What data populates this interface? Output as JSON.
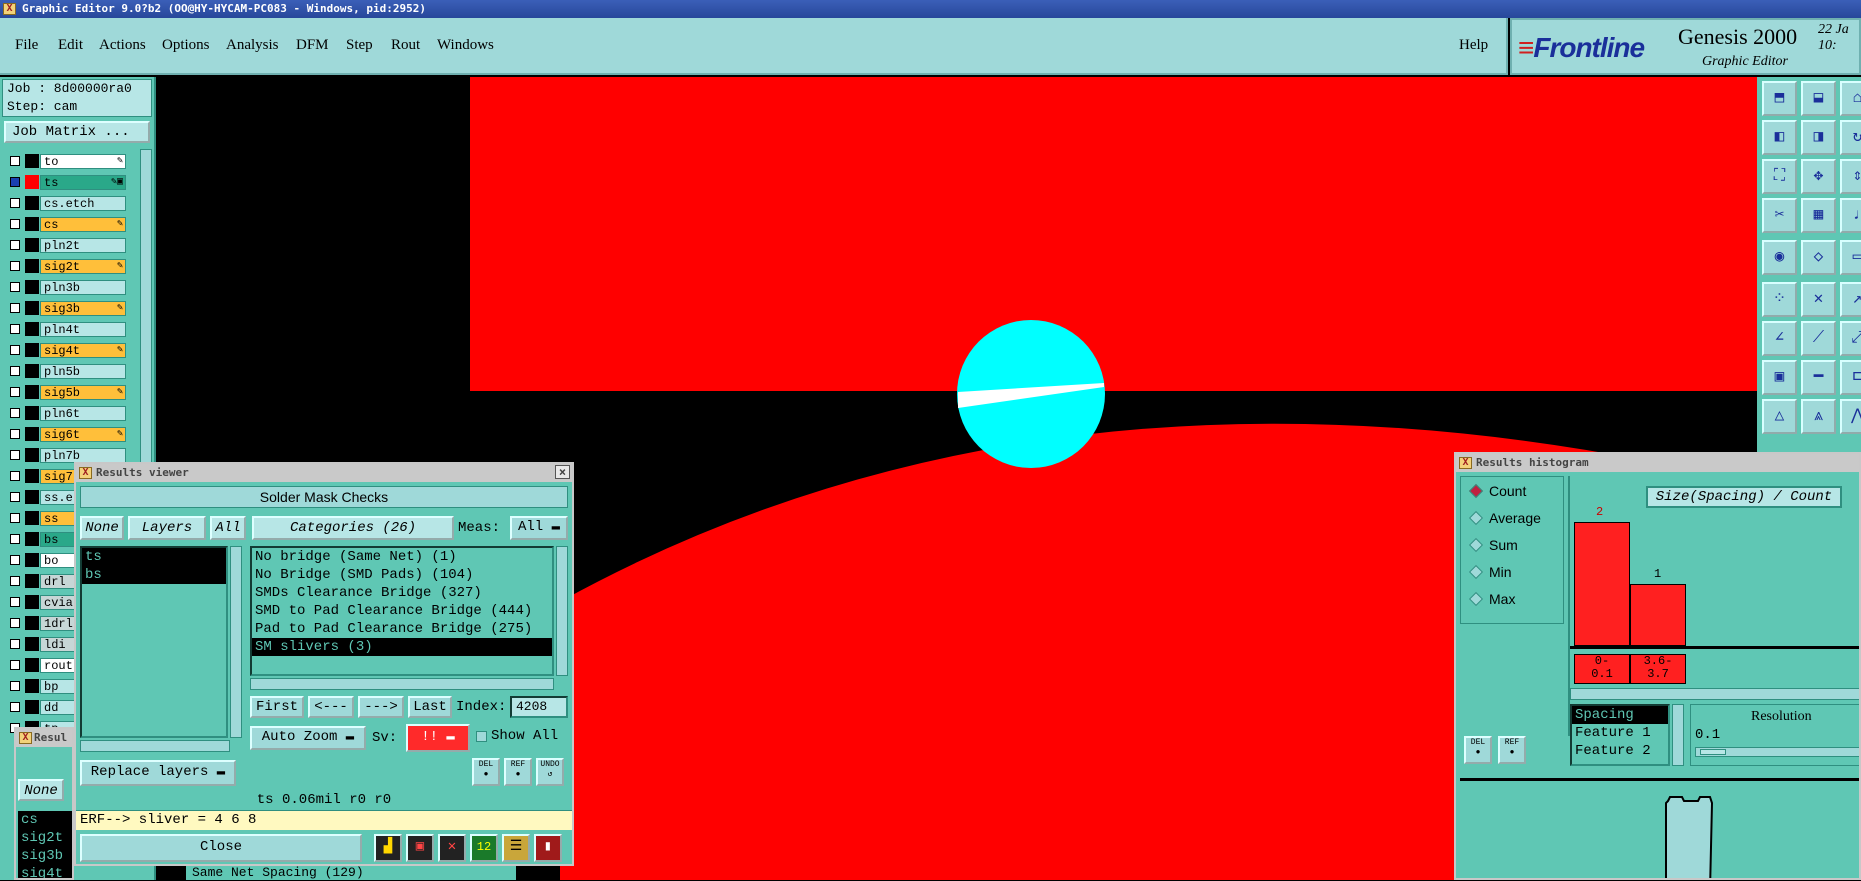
{
  "app": {
    "title": "Graphic Editor 9.0?b2 (OO@HY-HYCAM-PC083 - Windows, pid:2952)"
  },
  "menu": [
    "File",
    "Edit",
    "Actions",
    "Options",
    "Analysis",
    "DFM",
    "Step",
    "Rout",
    "Windows"
  ],
  "help": "Help",
  "logo": {
    "brand": "Frontline",
    "product": "Genesis 2000",
    "subtitle": "Graphic Editor",
    "date_line1": "22 Ja",
    "date_line2": "10:"
  },
  "job": {
    "job_line": "Job : 8d00000ra0",
    "step_line": "Step: cam",
    "matrix_button": "Job Matrix ..."
  },
  "layers": [
    {
      "name": "to",
      "style": "white",
      "marks": "✎"
    },
    {
      "name": "ts",
      "style": "green",
      "marks": "✎▣",
      "selected": true
    },
    {
      "name": "cs.etch",
      "style": "plain",
      "marks": ""
    },
    {
      "name": "cs",
      "style": "orange",
      "marks": "✎"
    },
    {
      "name": "pln2t",
      "style": "plain",
      "marks": ""
    },
    {
      "name": "sig2t",
      "style": "orange",
      "marks": "✎"
    },
    {
      "name": "pln3b",
      "style": "plain",
      "marks": ""
    },
    {
      "name": "sig3b",
      "style": "orange",
      "marks": "✎"
    },
    {
      "name": "pln4t",
      "style": "plain",
      "marks": ""
    },
    {
      "name": "sig4t",
      "style": "orange",
      "marks": "✎"
    },
    {
      "name": "pln5b",
      "style": "plain",
      "marks": ""
    },
    {
      "name": "sig5b",
      "style": "orange",
      "marks": "✎"
    },
    {
      "name": "pln6t",
      "style": "plain",
      "marks": ""
    },
    {
      "name": "sig6t",
      "style": "orange",
      "marks": "✎"
    },
    {
      "name": "pln7b",
      "style": "plain",
      "marks": ""
    },
    {
      "name": "sig7",
      "style": "orange",
      "marks": ""
    },
    {
      "name": "ss.e",
      "style": "plain",
      "marks": ""
    },
    {
      "name": "ss",
      "style": "orange",
      "marks": ""
    },
    {
      "name": "bs",
      "style": "green",
      "marks": ""
    },
    {
      "name": "bo",
      "style": "white",
      "marks": ""
    },
    {
      "name": "drl",
      "style": "gray",
      "marks": ""
    },
    {
      "name": "cvia",
      "style": "gray",
      "marks": ""
    },
    {
      "name": "1drl",
      "style": "gray",
      "marks": ""
    },
    {
      "name": "ldi",
      "style": "gray",
      "marks": ""
    },
    {
      "name": "rout",
      "style": "white",
      "marks": ""
    },
    {
      "name": "bp",
      "style": "plain",
      "marks": ""
    },
    {
      "name": "dd",
      "style": "plain",
      "marks": ""
    },
    {
      "name": "tp",
      "style": "plain",
      "marks": ""
    }
  ],
  "results_viewer": {
    "title": "Results viewer",
    "heading": "Solder Mask Checks",
    "none": "None",
    "layers": "Layers",
    "all": "All",
    "categories": "Categories (26)",
    "meas_label": "Meas:",
    "meas_value": "All",
    "layer_list": [
      "ts",
      "bs"
    ],
    "category_list": [
      "No bridge (Same Net) (1)",
      "No Bridge (SMD Pads) (104)",
      "SMDs Clearance Bridge (327)",
      "SMD to Pad Clearance Bridge (444)",
      "Pad to Pad Clearance Bridge (275)",
      "SM slivers (3)"
    ],
    "selected_category": 5,
    "first": "First",
    "prev": "<---",
    "next": "--->",
    "last": "Last",
    "index_label": "Index:",
    "index_value": "4208",
    "auto_zoom": "Auto Zoom",
    "sv_label": "Sv:",
    "sv_value": "!!",
    "show_all": "Show All",
    "replace_layers": "Replace layers",
    "status": "ts 0.06mil  r0  r0",
    "erf": "ERF--> sliver = 4 6 8",
    "close": "Close",
    "icon_del": "DEL",
    "icon_ref": "REF",
    "icon_undo": "UNDO"
  },
  "histogram": {
    "title": "Results histogram",
    "modes": [
      "Count",
      "Average",
      "Sum",
      "Min",
      "Max"
    ],
    "selected_mode": 0,
    "chart_title": "Size(Spacing) / Count",
    "bars": [
      {
        "label_top": "2",
        "bin_line1": "0-",
        "bin_line2": "0.1",
        "count": 2
      },
      {
        "label_top": "1",
        "bin_line1": "3.6-",
        "bin_line2": "3.7",
        "count": 1
      }
    ],
    "fields": [
      "Spacing",
      "Feature 1",
      "Feature 2"
    ],
    "resolution_label": "Resolution",
    "resolution_value": "0.1",
    "icon_del": "DEL",
    "icon_ref": "REF"
  },
  "small_results": {
    "title": "Resul",
    "none": "None",
    "items": [
      "cs",
      "sig2t",
      "sig3b",
      "sig4t"
    ]
  },
  "behind_text": "Same Net Spacing (129)"
}
